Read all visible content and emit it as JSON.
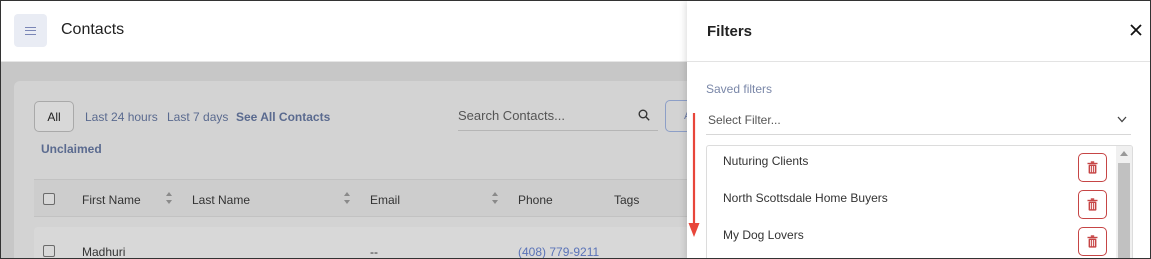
{
  "header": {
    "menu_icon": "hamburger-menu-icon",
    "title": "Contacts"
  },
  "contacts": {
    "tabs": {
      "all": "All",
      "last24": "Last 24 hours",
      "last7": "Last 7 days",
      "see_all": "See All Contacts",
      "unclaimed": "Unclaimed"
    },
    "search": {
      "placeholder": "Search Contacts..."
    },
    "table": {
      "columns": [
        "First Name",
        "Last Name",
        "Email",
        "Phone",
        "Tags"
      ],
      "rows": [
        {
          "first_name": "Madhuri",
          "last_name": "",
          "email": "--",
          "phone": "(408) 779-9211",
          "tags": ""
        }
      ]
    }
  },
  "filters_panel": {
    "title": "Filters",
    "saved_label": "Saved filters",
    "select_placeholder": "Select Filter...",
    "items": [
      {
        "label": "Nuturing Clients"
      },
      {
        "label": "North Scottsdale Home Buyers"
      },
      {
        "label": "My Dog Lovers"
      }
    ]
  },
  "colors": {
    "accent_link": "#5a73b8",
    "delete_red": "#c64545",
    "annotation_arrow": "#e8463a"
  }
}
